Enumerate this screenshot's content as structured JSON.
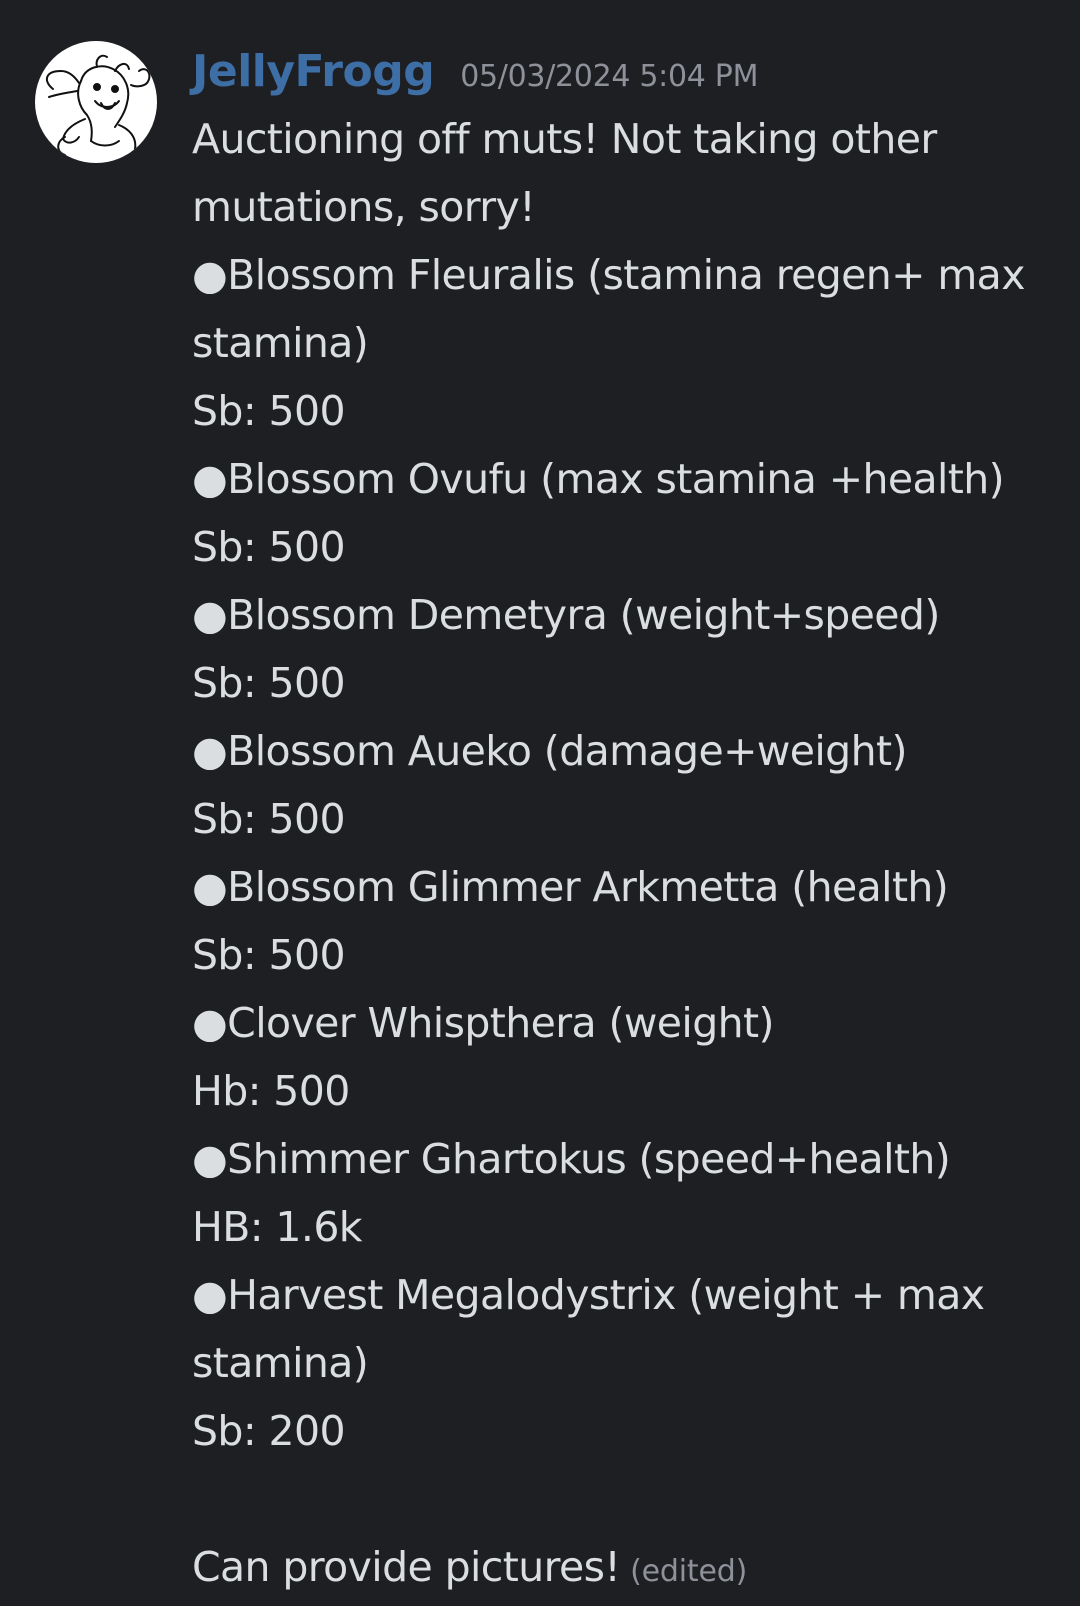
{
  "message": {
    "username": "JellyFrogg",
    "timestamp": "05/03/2024 5:04 PM",
    "lines": [
      "Auctioning off muts! Not taking other",
      "mutations, sorry!",
      "●Blossom Fleuralis (stamina regen+ max",
      "stamina)",
      "Sb: 500",
      "●Blossom Ovufu (max stamina +health)",
      "Sb: 500",
      "●Blossom Demetyra (weight+speed)",
      "Sb: 500",
      "●Blossom Aueko (damage+weight)",
      "Sb: 500",
      "●Blossom Glimmer Arkmetta (health)",
      "Sb: 500",
      "●Clover Whispthera (weight)",
      "Hb: 500",
      "●Shimmer Ghartokus (speed+health)",
      "HB: 1.6k",
      "●Harvest Megalodystrix (weight + max",
      "stamina)",
      "Sb: 200",
      "",
      "Can provide pictures!"
    ],
    "edited_label": "(edited)"
  },
  "colors": {
    "background": "#1e1f22",
    "username": "#3e6ea6",
    "text": "#dbdee1",
    "muted": "#8e9199"
  },
  "icons": {
    "avatar": "avatar-sketch-creature"
  }
}
